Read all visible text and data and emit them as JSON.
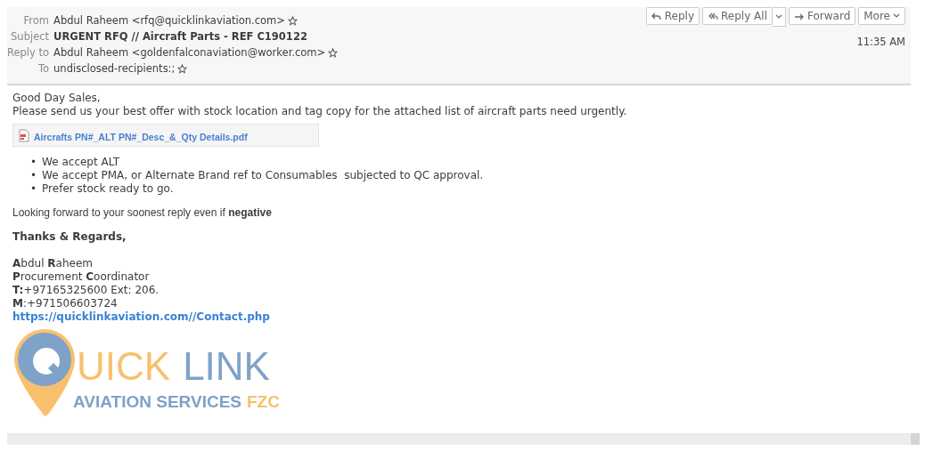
{
  "header": {
    "fields": [
      {
        "label": "From",
        "value": "Abdul Raheem <rfq@quicklinkaviation.com>",
        "bold": false,
        "starred": false
      },
      {
        "label": "Subject",
        "value": "URGENT RFQ // Aircraft Parts - REF C190122",
        "bold": true
      },
      {
        "label": "Reply to",
        "value": "Abdul Raheem <goldenfalconaviation@worker.com>",
        "bold": false,
        "starred": false
      },
      {
        "label": "To",
        "value": "undisclosed-recipients:;",
        "bold": false,
        "starred": false
      }
    ],
    "buttons": [
      {
        "label": "Reply",
        "split": false
      },
      {
        "label": "Reply All",
        "split": true
      },
      {
        "label": "Forward",
        "split": false
      },
      {
        "label": "More",
        "split": false
      }
    ],
    "time": "11:35 AM"
  },
  "body": {
    "greeting": "Good Day Sales,",
    "intro": "Please send us your best offer with stock location and tag copy for the attached list of aircraft parts need urgently.",
    "attachment": "Aircrafts PN#_ALT PN#_Desc_&_Qty Details.pdf",
    "bullets": [
      {
        "marker": "•",
        "text": "We accept ALT"
      },
      {
        "marker": "•",
        "text": "We accept PMA, or Alternate Brand ref to Consumables  subjected to QC approval."
      },
      {
        "marker": "•",
        "text": "Prefer stock ready to go."
      }
    ],
    "closing": "Looking forward to your soonest reply even if **negative**",
    "thanks": "Thanks & Regards,",
    "signature": [
      "**A**bdul **R**aheem",
      "**P**rocurement **C**oordinator",
      "**T:**+97165325600 Ext: 206.",
      "**M**:+971506603724"
    ],
    "link": "https://quicklinkaviation.com//Contact.php",
    "logo": {
      "word_1": "UICK",
      "word_2": "LINK",
      "tagline": "AVIATION SERVICES",
      "tagline_2": "FZC"
    }
  }
}
